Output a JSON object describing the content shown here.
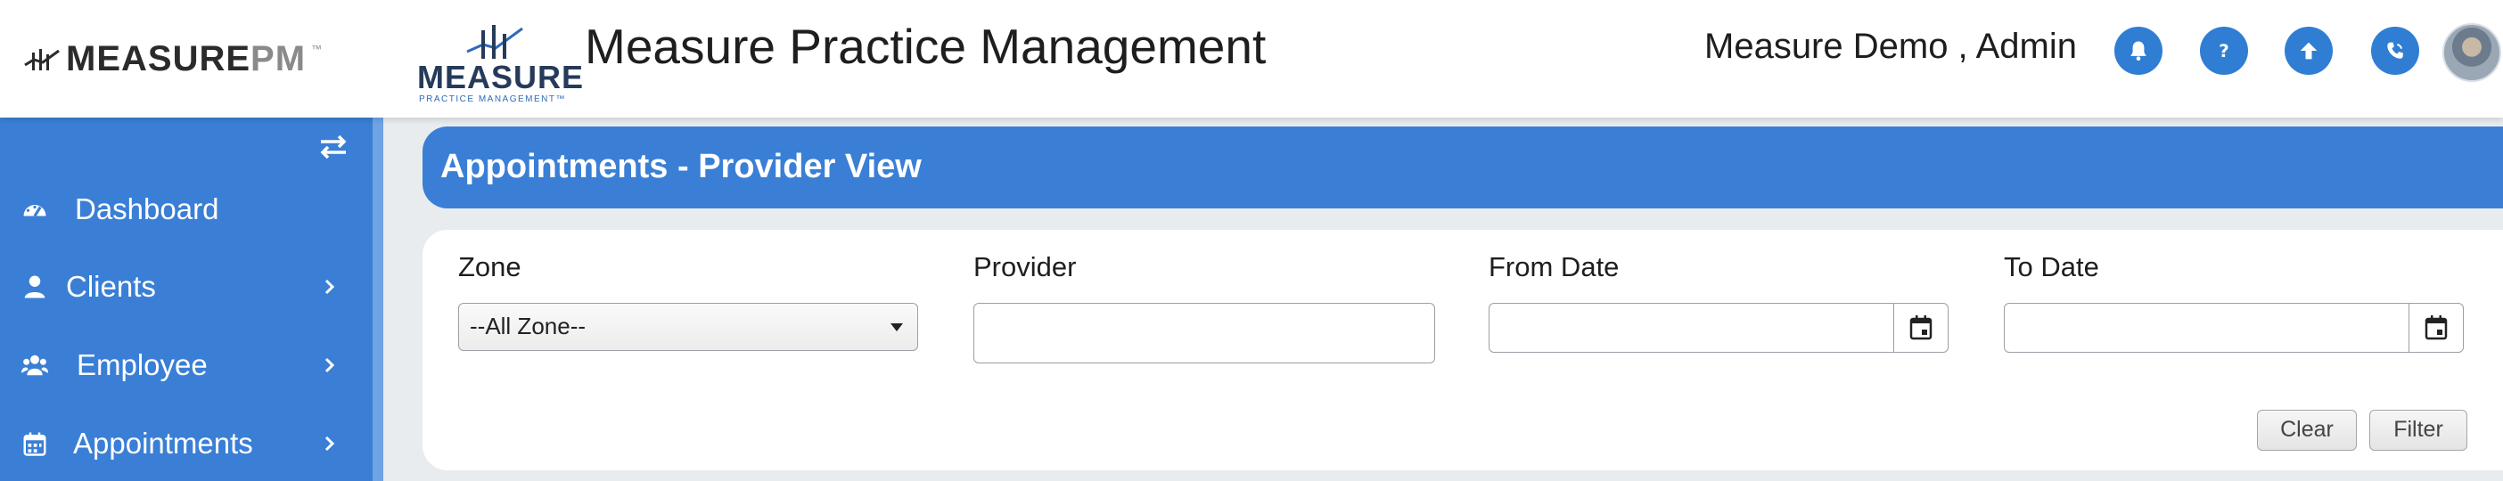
{
  "header": {
    "brand_main": "MEASURE",
    "brand_pm": "PM",
    "brand_tm": "™",
    "logo_word": "MEASURE",
    "logo_sub": "PRACTICE MANAGEMENT™",
    "app_title": "Measure Practice Management",
    "user_name": "Measure Demo , Admin",
    "icons": [
      "bell-icon",
      "help-icon",
      "upload-icon",
      "phone-icon"
    ],
    "accent_color": "#2f7ed4"
  },
  "sidebar": {
    "background": "#3a7fd5",
    "items": [
      {
        "label": "Dashboard",
        "icon": "dashboard-gauge-icon",
        "has_submenu": false
      },
      {
        "label": "Clients",
        "icon": "user-icon",
        "has_submenu": true
      },
      {
        "label": "Employee",
        "icon": "users-group-icon",
        "has_submenu": true
      },
      {
        "label": "Appointments",
        "icon": "calendar-icon",
        "has_submenu": true
      }
    ]
  },
  "main": {
    "page_title": "Appointments - Provider View",
    "filters": {
      "zone_label": "Zone",
      "zone_value": "--All Zone--",
      "provider_label": "Provider",
      "provider_value": "",
      "from_date_label": "From Date",
      "from_date_value": "",
      "to_date_label": "To Date",
      "to_date_value": ""
    },
    "buttons": {
      "clear": "Clear",
      "filter": "Filter"
    }
  }
}
